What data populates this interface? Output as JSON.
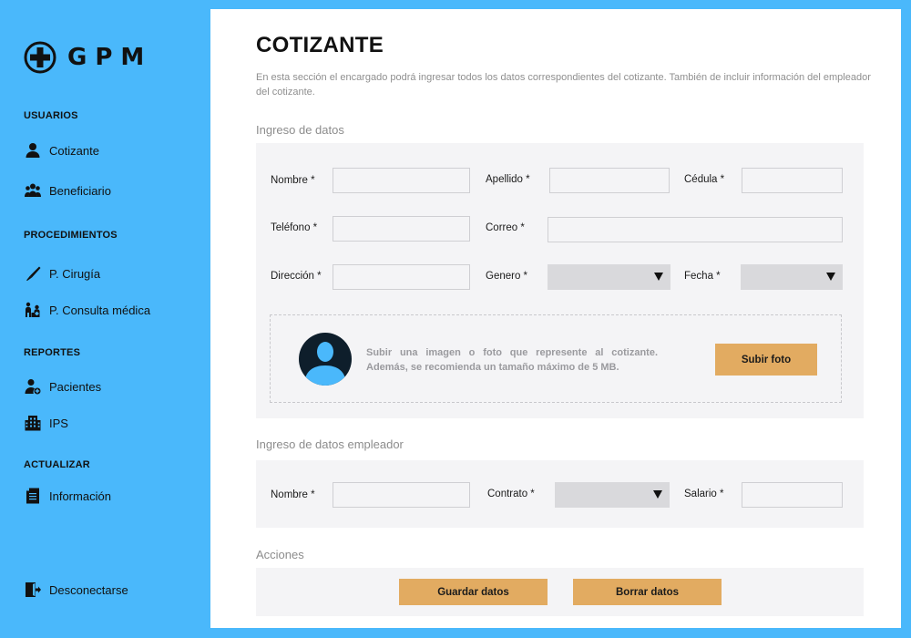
{
  "brand": {
    "name": "GPM",
    "icon": "plus-cross-logo"
  },
  "sidebar": {
    "sections": [
      {
        "title": "USUARIOS",
        "items": [
          {
            "label": "Cotizante",
            "icon": "user-icon"
          },
          {
            "label": "Beneficiario",
            "icon": "group-icon"
          }
        ]
      },
      {
        "title": "PROCEDIMIENTOS",
        "items": [
          {
            "label": "P. Cirugía",
            "icon": "scalpel-icon"
          },
          {
            "label": "P. Consulta médica",
            "icon": "consultation-icon"
          }
        ]
      },
      {
        "title": "REPORTES",
        "items": [
          {
            "label": "Pacientes",
            "icon": "patient-icon"
          },
          {
            "label": "IPS",
            "icon": "building-icon"
          }
        ]
      },
      {
        "title": "ACTUALIZAR",
        "items": [
          {
            "label": "Información",
            "icon": "document-icon"
          }
        ]
      }
    ],
    "logout": {
      "label": "Desconectarse",
      "icon": "logout-icon"
    }
  },
  "page": {
    "title": "COTIZANTE",
    "description": "En esta sección el encargado podrá ingresar todos los datos correspondientes del cotizante. También de incluir información del empleador del cotizante."
  },
  "personal": {
    "title": "Ingreso de datos",
    "nombre_label": "Nombre *",
    "apellido_label": "Apellido *",
    "cedula_label": "Cédula *",
    "telefono_label": "Teléfono *",
    "correo_label": "Correo *",
    "direccion_label": "Dirección *",
    "genero_label": "Genero *",
    "fecha_label": "Fecha *",
    "nombre_value": "",
    "apellido_value": "",
    "cedula_value": "",
    "telefono_value": "",
    "correo_value": "",
    "direccion_value": "",
    "genero_value": "",
    "fecha_value": "",
    "upload_text": "Subir una imagen o foto que represente al cotizante. Además, se recomienda un tamaño máximo de 5 MB.",
    "upload_button": "Subir foto"
  },
  "employer": {
    "title": "Ingreso de datos empleador",
    "nombre_label": "Nombre *",
    "contrato_label": "Contrato *",
    "salario_label": "Salario *",
    "nombre_value": "",
    "contrato_value": "",
    "salario_value": ""
  },
  "actions": {
    "title": "Acciones",
    "save_label": "Guardar datos",
    "clear_label": "Borrar datos"
  },
  "colors": {
    "sidebar_bg": "#4ab8fb",
    "panel_bg": "#f4f4f6",
    "button": "#e2ab61",
    "select_bg": "#d9d9dc"
  }
}
